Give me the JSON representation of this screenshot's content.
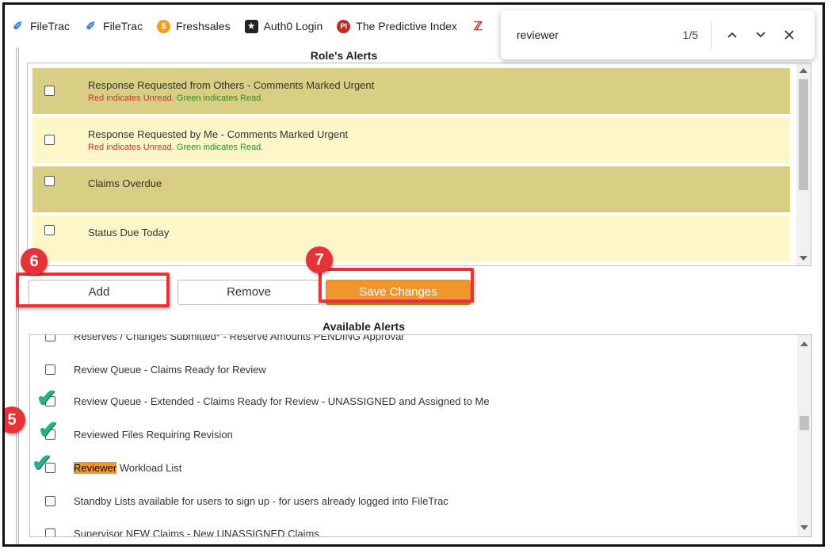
{
  "bookmarks": [
    {
      "label": "FileTrac",
      "icon": "filetrac-icon"
    },
    {
      "label": "FileTrac",
      "icon": "filetrac-icon"
    },
    {
      "label": "Freshsales",
      "icon": "freshsales-icon"
    },
    {
      "label": "Auth0 Login",
      "icon": "auth0-icon"
    },
    {
      "label": "The Predictive Index",
      "icon": "predictive-index-icon"
    }
  ],
  "find": {
    "query": "reviewer",
    "count": "1/5",
    "up": "^",
    "down": "v",
    "close": "✕"
  },
  "roles_alerts": {
    "title": "Role's Alerts",
    "items": [
      {
        "label": "Response Requested from Others - Comments Marked Urgent",
        "sub_red": "Red indicates Unread.",
        "sub_green": "Green indicates Read.",
        "shade": "dark"
      },
      {
        "label": "Response Requested by Me - Comments Marked Urgent",
        "sub_red": "Red indicates Unread.",
        "sub_green": "Green indicates Read.",
        "shade": "light"
      },
      {
        "label": "Claims Overdue",
        "shade": "dark"
      },
      {
        "label": "Status Due Today",
        "shade": "light"
      }
    ]
  },
  "buttons": {
    "add": "Add",
    "remove": "Remove",
    "save": "Save Changes"
  },
  "badges": {
    "five": "5",
    "six": "6",
    "seven": "7"
  },
  "available_alerts": {
    "title": "Available Alerts",
    "items": [
      "Reserves / Changes Submitted* - Reserve Amounts PENDING Approval",
      "Review Queue - Claims Ready for Review",
      "Review Queue - Extended - Claims Ready for Review - UNASSIGNED and Assigned to Me",
      "Reviewed Files Requiring Revision",
      "Workload List",
      "Standby Lists available for users to sign up - for users already logged into FileTrac",
      "Supervisor NEW Claims - New UNASSIGNED Claims"
    ],
    "match_text": "Reviewer"
  },
  "colors": {
    "accent": "#f0962e",
    "highlight_red": "#e8323a",
    "check_green": "#29b08a",
    "row_dark": "#d8ce84",
    "row_light": "#fcf6c8"
  }
}
